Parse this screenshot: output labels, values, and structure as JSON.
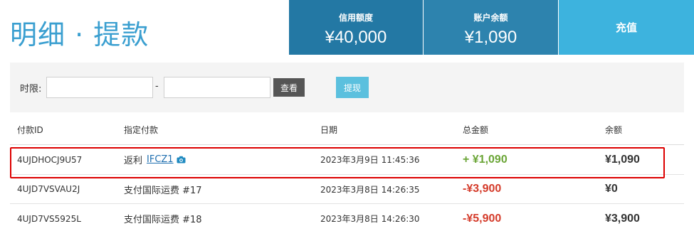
{
  "page_title": "明细 · 提款",
  "stats": {
    "credit_label": "信用额度",
    "credit_value": "¥40,000",
    "balance_label": "账户余额",
    "balance_value": "¥1,090"
  },
  "recharge_label": "充值",
  "filter": {
    "label": "时限:",
    "start_value": "",
    "separator": "-",
    "end_value": "",
    "view_label": "查看",
    "withdraw_label": "提现"
  },
  "table": {
    "headers": [
      "付款ID",
      "指定付款",
      "日期",
      "总金额",
      "余额"
    ],
    "rows": [
      {
        "id": "4UJDHOCJ9U57",
        "desc": "返利",
        "ref": "IFCZ1",
        "date": "2023年3月9日 11:45:36",
        "amount": "+ ¥1,090",
        "balance": "¥1,090"
      },
      {
        "id": "4UJD7VSVAU2J",
        "desc": "支付国际运费 #17",
        "date": "2023年3月8日 14:26:35",
        "amount": "-¥3,900",
        "balance": "¥0"
      },
      {
        "id": "4UJD7VS5925L",
        "desc": "支付国际运费 #18",
        "date": "2023年3月8日 14:26:30",
        "amount": "-¥5,900",
        "balance": "¥3,900"
      }
    ]
  },
  "icons": {
    "ref_icon": "camera-icon"
  },
  "colors": {
    "title": "#3a9fd0",
    "credit_bg": "#2378a4",
    "balance_bg": "#2d83ae",
    "recharge_bg": "#3db3de",
    "positive": "#6aa536",
    "negative": "#d43b2a",
    "highlight": "#dd0000"
  }
}
